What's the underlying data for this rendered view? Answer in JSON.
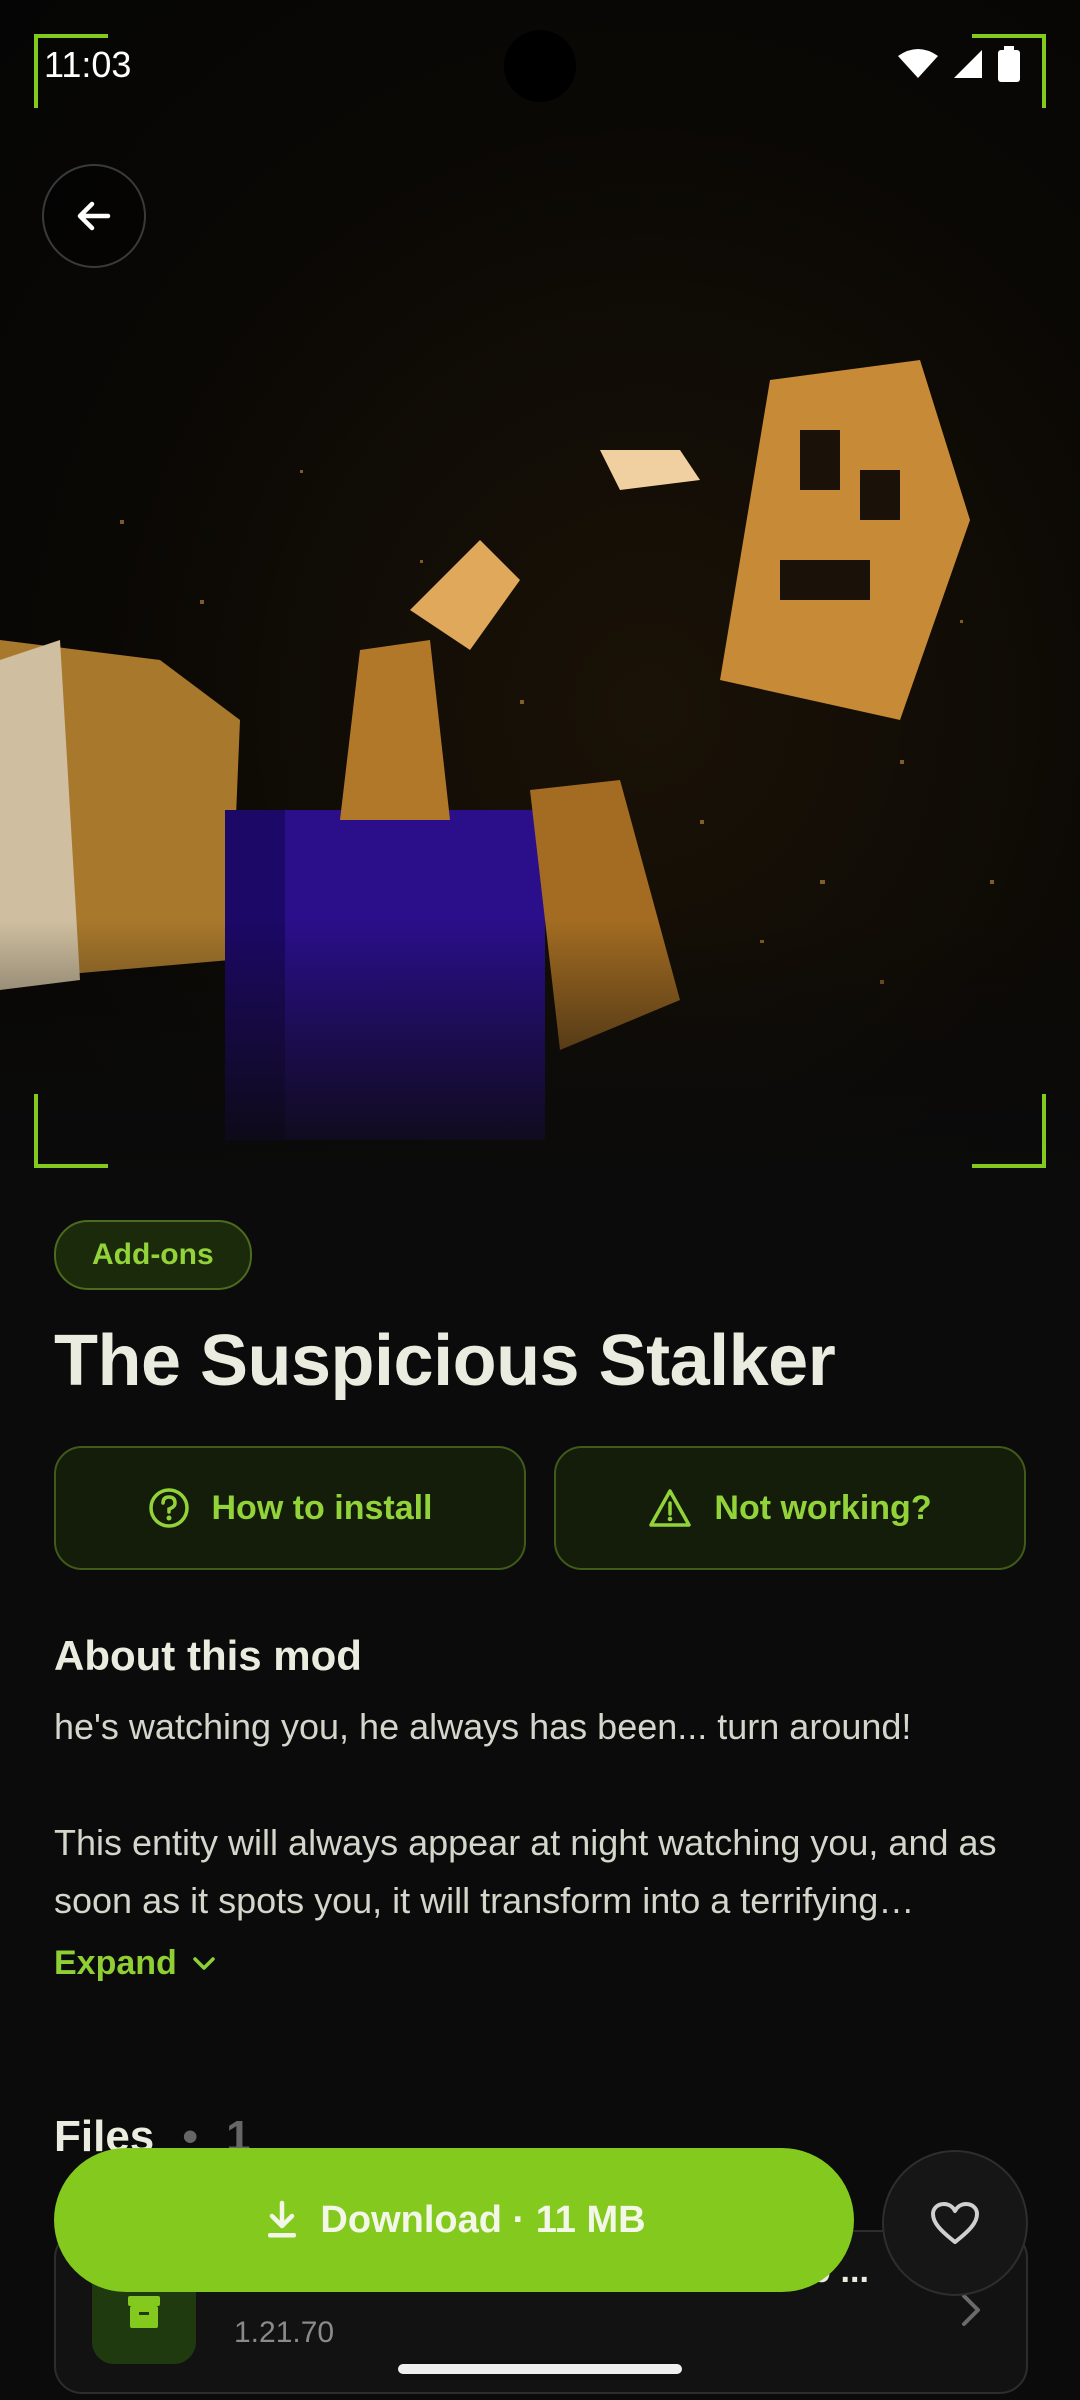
{
  "status_bar": {
    "time": "11:03"
  },
  "hero": {
    "back_icon": "arrow-left-icon"
  },
  "mod": {
    "category": "Add-ons",
    "title": "The Suspicious Stalker",
    "how_to_install": "How to install",
    "not_working": "Not working?",
    "about_title": "About this mod",
    "about_line1": "he's watching you, he always has been... turn around!",
    "about_line2": "This entity will always appear at night watching you, and as soon as it spots you, it will transform into a terrifying creature...",
    "expand_label": "Expand"
  },
  "files": {
    "title": "Files",
    "separator": "•",
    "count": "1",
    "items": [
      {
        "name": "A͂A§oThe Suspicious Stalker (1.21.70 ...",
        "version": "1.21.70"
      }
    ]
  },
  "actions": {
    "download_label": "Download · 11 MB",
    "favorite_icon": "heart-icon"
  },
  "colors": {
    "accent": "#84c91e",
    "background": "#0b0b0b"
  }
}
